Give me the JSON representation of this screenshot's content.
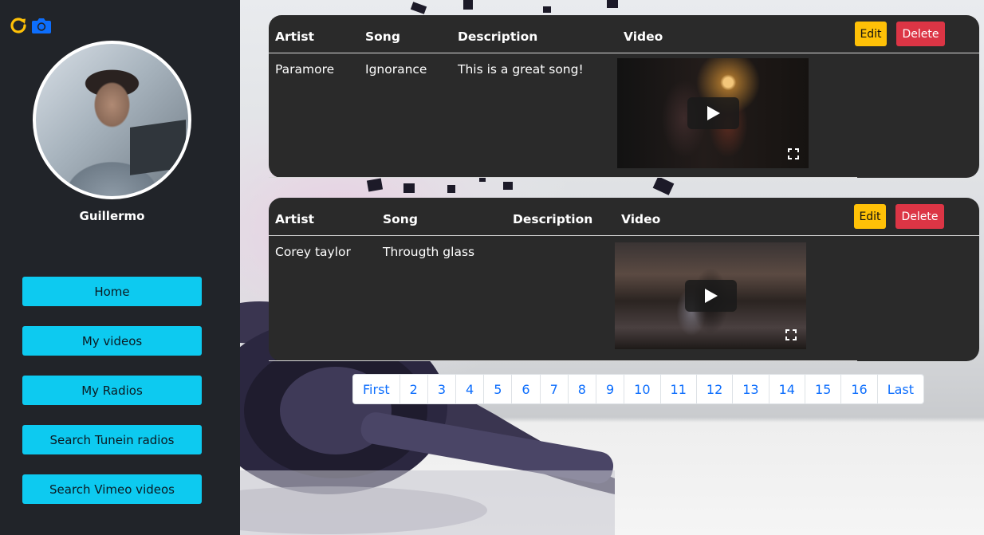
{
  "sidebar": {
    "icons": [
      "refresh-icon",
      "camera-icon"
    ],
    "username": "Guillermo",
    "nav": [
      {
        "label": "Home"
      },
      {
        "label": "My videos"
      },
      {
        "label": "My Radios"
      },
      {
        "label": "Search Tunein radios"
      },
      {
        "label": "Search Vimeo videos"
      }
    ]
  },
  "headers": {
    "artist": "Artist",
    "song": "Song",
    "description": "Description",
    "video": "Video"
  },
  "actions": {
    "edit": "Edit",
    "delete": "Delete"
  },
  "records": [
    {
      "artist": "Paramore",
      "song": "Ignorance",
      "description": "This is a great song!"
    },
    {
      "artist": "Corey taylor",
      "song": "Througth glass",
      "description": ""
    }
  ],
  "pagination": [
    "First",
    "2",
    "3",
    "4",
    "5",
    "6",
    "7",
    "8",
    "9",
    "10",
    "11",
    "12",
    "13",
    "14",
    "15",
    "16",
    "Last"
  ],
  "colors": {
    "sidebar_bg": "#212429",
    "nav_button": "#0dcaf0",
    "edit_button": "#ffc107",
    "delete_button": "#dc3545",
    "card_bg": "#2a2a2a",
    "link": "#0d6efd"
  }
}
